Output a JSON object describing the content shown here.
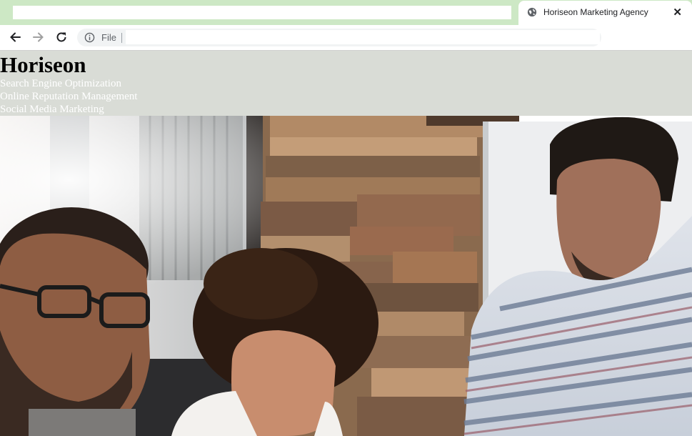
{
  "browser": {
    "tab": {
      "title": "Horiseon Marketing Agency",
      "favicon": "globe-icon",
      "close_glyph": "✕"
    },
    "toolbar": {
      "back_icon": "back-arrow-icon",
      "forward_icon": "forward-arrow-icon",
      "reload_icon": "reload-icon",
      "info_icon": "info-icon",
      "scheme_label": "File",
      "url": ""
    }
  },
  "page": {
    "header": {
      "title": "Horiseon",
      "nav": [
        {
          "label": "Search Engine Optimization"
        },
        {
          "label": "Online Reputation Management"
        },
        {
          "label": "Social Media Marketing"
        }
      ],
      "background": "#d9dcd6",
      "nav_text_color": "#ffffff"
    },
    "hero": {
      "description_icon": "team-photo"
    }
  }
}
